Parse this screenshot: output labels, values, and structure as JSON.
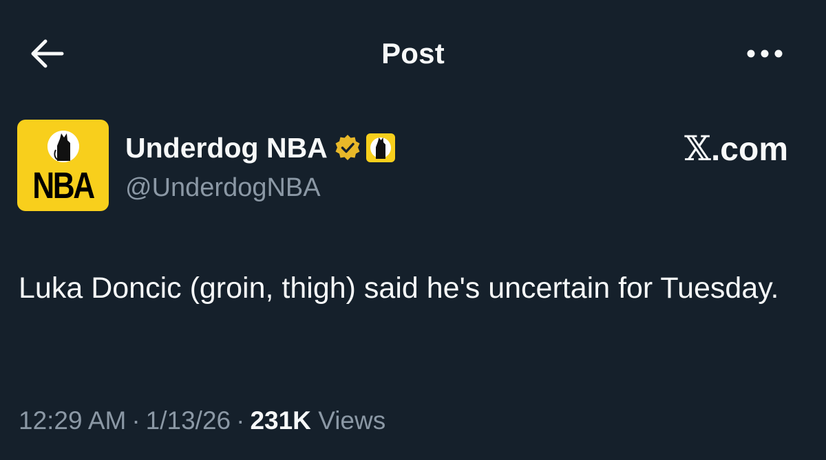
{
  "header": {
    "title": "Post",
    "back_icon": "arrow-left-icon",
    "more_icon": "more-horizontal-icon"
  },
  "author": {
    "display_name": "Underdog NBA",
    "handle": "@UnderdogNBA",
    "avatar_text": "NBA",
    "verified_badge_color": "#e8b829",
    "brand_color": "#f8cf1c"
  },
  "watermark": {
    "x_glyph": "𝕏",
    "domain": ".com"
  },
  "post": {
    "text": "Luka Doncic (groin, thigh) said he's uncertain for Tuesday."
  },
  "meta": {
    "time": "12:29 AM",
    "date": "1/13/26",
    "separator": "·",
    "views_count": "231K",
    "views_label": "Views"
  },
  "colors": {
    "background": "#15202b",
    "text_primary": "#f7f9f9",
    "text_secondary": "#8b98a5"
  }
}
